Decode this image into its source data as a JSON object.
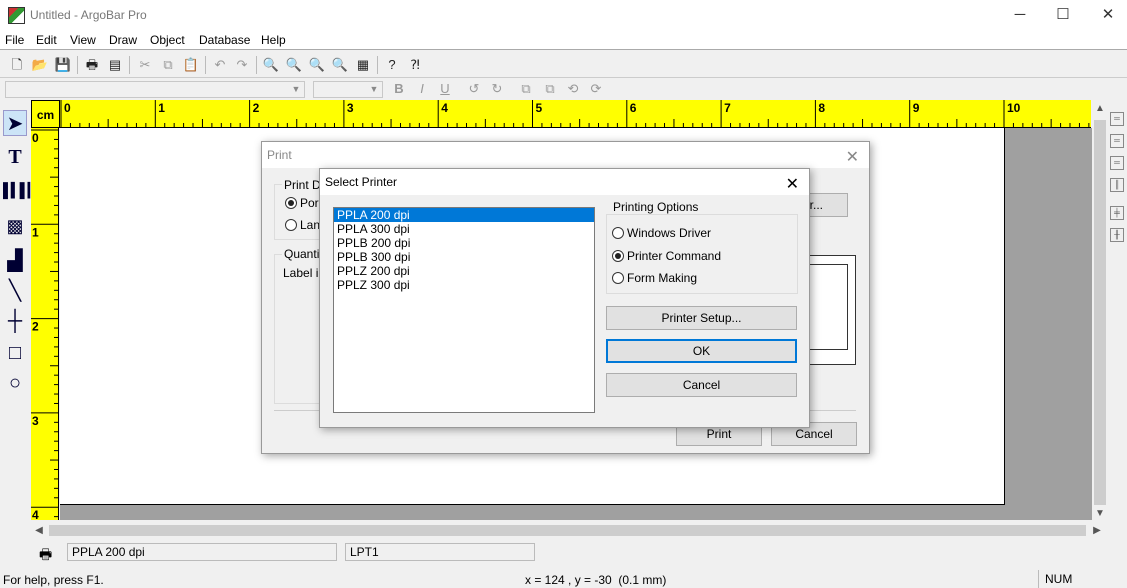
{
  "window": {
    "title": "Untitled - ArgoBar Pro",
    "minimize": "─",
    "maximize": "☐",
    "close": "✕"
  },
  "menu": [
    "File",
    "Edit",
    "View",
    "Draw",
    "Object",
    "Database",
    "Help"
  ],
  "ruler": {
    "unit": "cm",
    "h_labels": [
      "0",
      "1",
      "2",
      "3",
      "4",
      "5",
      "6",
      "7",
      "8",
      "9",
      "10"
    ],
    "v_labels": [
      "0",
      "1",
      "2",
      "3",
      "4"
    ]
  },
  "statusbar": {
    "printer_name": "PPLA 200 dpi",
    "port": "LPT1",
    "help_text": "For help, press F1.",
    "coords": "x = 124 , y = -30  (0.1 mm)",
    "num": "NUM"
  },
  "print_dialog": {
    "title": "Print",
    "print_direction_label": "Print D",
    "portrait_label": "Por",
    "landscape_label": "Lan",
    "quantity_label": "Quanti",
    "label_info_label": "Label in",
    "setup_button_partial": "er...",
    "print_button": "Print",
    "cancel_button": "Cancel"
  },
  "select_printer": {
    "title": "Select Printer",
    "printers": [
      "PPLA 200 dpi",
      "PPLA 300 dpi",
      "PPLB 200 dpi",
      "PPLB 300 dpi",
      "PPLZ 200 dpi",
      "PPLZ 300 dpi"
    ],
    "selected_index": 0,
    "options_label": "Printing Options",
    "options": [
      {
        "label": "Windows Driver",
        "checked": false
      },
      {
        "label": "Printer Command",
        "checked": true
      },
      {
        "label": "Form Making",
        "checked": false
      }
    ],
    "setup_button": "Printer Setup...",
    "ok_button": "OK",
    "cancel_button": "Cancel"
  }
}
